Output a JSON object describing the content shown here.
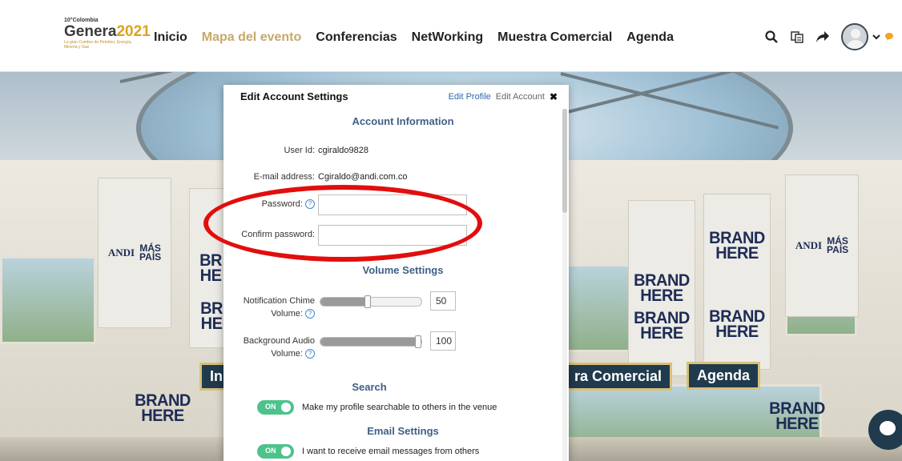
{
  "logo": {
    "top_text": "10°Colombia",
    "main_text": "Genera",
    "year_text": "2021",
    "sub_text": "La gran Cumbre de Petróleo, Energía, Minería y Gas"
  },
  "nav": {
    "items": [
      {
        "label": "Inicio"
      },
      {
        "label": "Mapa del evento"
      },
      {
        "label": "Conferencias"
      },
      {
        "label": "NetWorking"
      },
      {
        "label": "Muestra Comercial"
      },
      {
        "label": "Agenda"
      }
    ]
  },
  "top_icons": [
    "search-icon",
    "translate-icon",
    "share-icon",
    "avatar",
    "chevron-down-icon",
    "chat-icon"
  ],
  "scene": {
    "brand_line1": "BRAND",
    "brand_line2": "HERE",
    "andi_text": "ANDI",
    "mas_text": "MÁS",
    "pais_text": "PAÍS",
    "sign_inicio": "Ini",
    "sign_comercial": "ra Comercial",
    "sign_agenda": "Agenda",
    "partial_br": "BR",
    "partial_he": "HE"
  },
  "modal": {
    "title": "Edit Account Settings",
    "edit_profile_link": "Edit Profile",
    "edit_account_link": "Edit Account",
    "close_label": "✖",
    "account_info_title": "Account Information",
    "user_id_label": "User Id:",
    "user_id_value": "cgiraldo9828",
    "email_label": "E-mail address:",
    "email_value": "Cgiraldo@andi.com.co",
    "password_label": "Password:",
    "confirm_password_label": "Confirm password:",
    "help_glyph": "?",
    "volume_title": "Volume Settings",
    "notification_label_1": "Notification Chime",
    "notification_label_2": "Volume:",
    "notification_value": "50",
    "notification_fraction": 0.5,
    "background_label_1": "Background Audio",
    "background_label_2": "Volume:",
    "background_value": "100",
    "background_fraction": 1.0,
    "search_title": "Search",
    "search_toggle_label": "ON",
    "search_toggle_text": "Make my profile searchable to others in the venue",
    "email_title": "Email Settings",
    "email_toggle_label": "ON",
    "email_toggle_text": "I want to receive email messages from others"
  },
  "colors": {
    "nav_active": "#c7a96a",
    "section_title": "#3f5f86",
    "link": "#2c68b3",
    "toggle_on": "#4dc38b",
    "annotation": "#e20d0d",
    "brand_text": "#1d2b55"
  }
}
